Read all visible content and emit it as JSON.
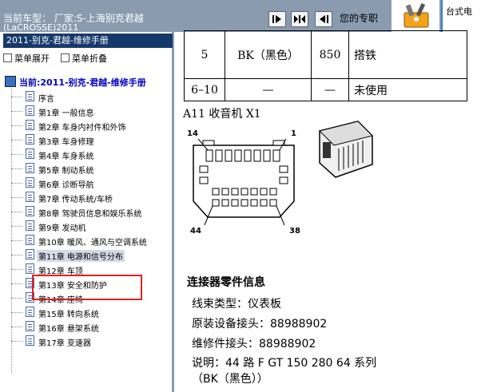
{
  "top": {
    "vehicle_line1": "当前车型：  厂家:S-上海别克君越",
    "vehicle_line2": "(LaCROSSE)2011",
    "pro_label": "您的专职",
    "topright_label": "台式电"
  },
  "sidebar": {
    "header": "2011-别克-君越-维修手册",
    "expand_label": "菜单展开",
    "collapse_label": "菜单折叠",
    "root": "当前:2011-别克-君越-维修手册",
    "items": [
      {
        "label": "序言"
      },
      {
        "label": "第1章 一般信息"
      },
      {
        "label": "第2章 车身内衬件和外饰"
      },
      {
        "label": "第3章 车身修理"
      },
      {
        "label": "第4章 车身系统"
      },
      {
        "label": "第5章 制动系统"
      },
      {
        "label": "第6章 诊断导航"
      },
      {
        "label": "第7章 传动系统/车桥"
      },
      {
        "label": "第8章 驾驶员信息和娱乐系统"
      },
      {
        "label": "第9章 发动机"
      },
      {
        "label": "第10章 暖风、通风与空调系统"
      },
      {
        "label": "第11章 电源和信号分布",
        "selected": true
      },
      {
        "label": "第12章 车顶"
      },
      {
        "label": "第13章 安全和防护"
      },
      {
        "label": "第14章 座椅"
      },
      {
        "label": "第15章 转向系统"
      },
      {
        "label": "第16章 悬架系统"
      },
      {
        "label": "第17章 变速器"
      }
    ]
  },
  "content": {
    "table_rows": [
      [
        "5",
        "BK（黑色）",
        "850",
        "搭铁"
      ],
      [
        "6–10",
        "—",
        "—",
        "未使用"
      ]
    ],
    "caption": "A11 收音机 X1",
    "pins": {
      "p14": "14",
      "p1": "1",
      "p44": "44",
      "p38": "38"
    },
    "info_title": "连接器零件信息",
    "info_lines": [
      "线束类型：仪表板",
      "原装设备接头：88988902",
      "维修件接头：88988902",
      "说明：44 路 F GT 150 280 64 系列",
      "（BK（黑色））"
    ]
  },
  "colors": {
    "topbar": "#8a9bb0",
    "header": "#16396b",
    "highlight": "#e02020"
  }
}
